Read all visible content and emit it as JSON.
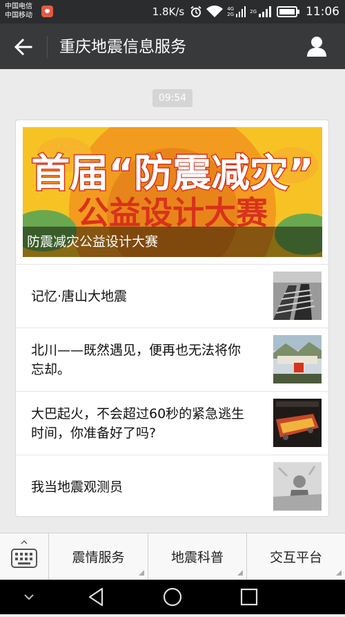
{
  "status_bar": {
    "carrier_1": "中国电信",
    "carrier_2": "中国移动",
    "net_speed": "1.8K/s",
    "net_type_top": "4G",
    "net_type_bottom": "2G",
    "net_type_2": "2G",
    "time": "11:06",
    "icons": [
      "alarm-icon",
      "wifi-icon",
      "signal-icon",
      "battery-icon"
    ]
  },
  "header": {
    "title": "重庆地震信息服务",
    "back_icon": "back-arrow-icon",
    "profile_icon": "person-icon"
  },
  "message": {
    "time": "09:54",
    "banner": {
      "line1": "首届“防震减灾”",
      "line2": "公益设计大赛",
      "caption": "防震减灾公益设计大赛"
    },
    "items": [
      {
        "title": "记忆·唐山大地震"
      },
      {
        "title": "北川——既然遇见，便再也无法将你忘却。"
      },
      {
        "title": "大巴起火，不会超过60秒的紧急逃生时间，你准备好了吗?"
      },
      {
        "title": "我当地震观测员"
      }
    ]
  },
  "menu": {
    "items": [
      "震情服务",
      "地震科普",
      "交互平台"
    ],
    "keyboard_icon": "keyboard-icon"
  },
  "nav": [
    "back-triangle-icon",
    "home-circle-icon",
    "recents-square-icon"
  ],
  "colors": {
    "status_bar": "#2b2c2e",
    "title_bar": "#38393b",
    "background": "#ebebeb",
    "banner_orange": "#f29b1f",
    "banner_red": "#d8321c"
  }
}
